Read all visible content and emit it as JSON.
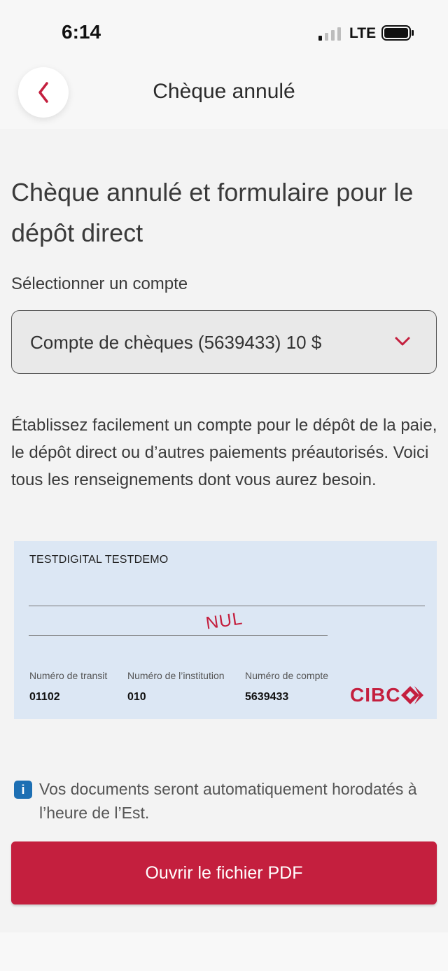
{
  "status_bar": {
    "time": "6:14",
    "network": "LTE"
  },
  "nav": {
    "title": "Chèque annulé",
    "back_icon": "chevron-left-icon"
  },
  "content": {
    "heading": "Chèque annulé et formulaire pour le dépôt direct",
    "select_label": "Sélectionner un compte",
    "selected_account": "Compte de chèques (5639433) 10 $",
    "description": "Établissez facilement un compte pour le dépôt de la paie, le dépôt direct ou d’autres paiements préautorisés. Voici tous les renseignements dont vous aurez besoin."
  },
  "cheque": {
    "name": "TESTDIGITAL TESTDEMO",
    "void_text": "NUL",
    "transit_label": "Numéro de transit",
    "transit_value": "01102",
    "institution_label": "Numéro de l’institution",
    "institution_value": "010",
    "account_label": "Numéro de compte",
    "account_value": "5639433",
    "logo_text": "CIBC"
  },
  "info": {
    "icon": "info-icon",
    "text": "Vos documents seront automatiquement horodatés à l’heure de l’Est."
  },
  "actions": {
    "open_pdf": "Ouvrir le fichier PDF"
  },
  "colors": {
    "brand": "#c41f3e",
    "cheque_bg": "#dce7f4",
    "info": "#1d6fb3"
  }
}
